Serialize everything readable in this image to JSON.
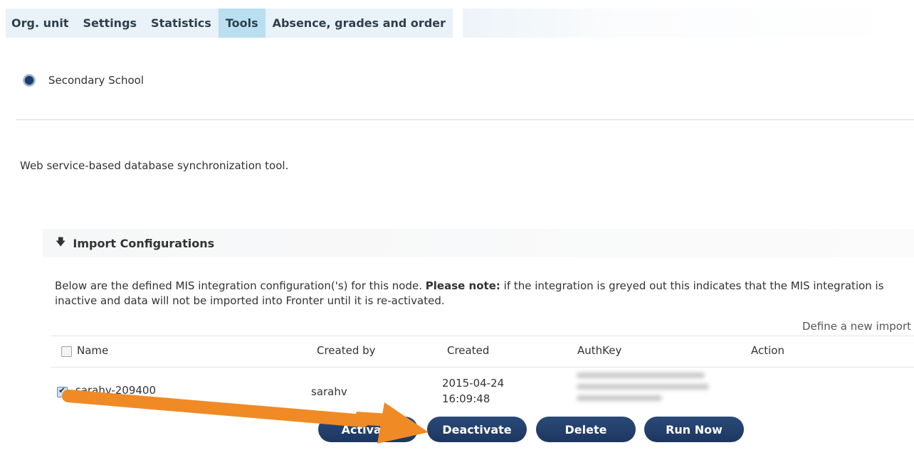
{
  "tabs": [
    {
      "label": "Org. unit"
    },
    {
      "label": "Settings"
    },
    {
      "label": "Statistics"
    },
    {
      "label": "Tools",
      "active": true
    },
    {
      "label": "Absence, grades and order"
    }
  ],
  "org_unit": {
    "name": "Secondary School"
  },
  "tool_description": "Web service-based database synchronization tool.",
  "import_section": {
    "title": "Import Configurations",
    "note_prefix": "Below are the defined MIS integration configuration('s) for this node.",
    "note_bold": "Please note:",
    "note_suffix": "if the integration is greyed out this indicates that the MIS integration is inactive and data will not be imported into Fronter until it is re-activated.",
    "define_link": "Define a new import"
  },
  "table": {
    "columns": [
      "Name",
      "Created by",
      "Created",
      "AuthKey",
      "Action"
    ],
    "rows": [
      {
        "name": "sarahv-209400",
        "created_by": "sarahv",
        "created_date": "2015-04-24",
        "created_time": "16:09:48",
        "checked": true
      }
    ]
  },
  "buttons": {
    "activate": "Activate",
    "deactivate": "Deactivate",
    "delete": "Delete",
    "run_now": "Run Now"
  },
  "colors": {
    "button_bg": "#1d3660",
    "tab_active": "#b9dff0",
    "annotation_arrow": "#f08a24"
  }
}
